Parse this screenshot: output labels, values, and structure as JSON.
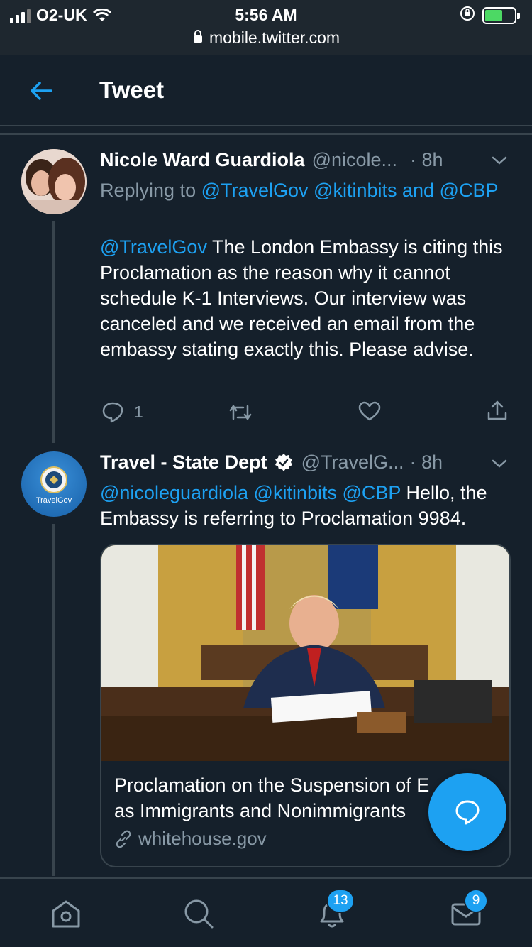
{
  "status_bar": {
    "carrier": "O2-UK",
    "time": "5:56 AM",
    "url": "mobile.twitter.com"
  },
  "header": {
    "title": "Tweet"
  },
  "tweet1": {
    "name": "Nicole Ward Guardiola",
    "handle": "@nicole...",
    "time": "· 8h",
    "replying_prefix": "Replying to",
    "replying_mentions": "@TravelGov @kitinbits and @CBP",
    "mention": "@TravelGov",
    "text": "The London Embassy is citing this Proclamation as the reason why it cannot schedule K-1 Interviews. Our interview was canceled and we received an email from the embassy stating exactly this. Please advise.",
    "reply_count": "1"
  },
  "tweet2": {
    "name": "Travel - State Dept",
    "handle": "@TravelG...",
    "time": "· 8h",
    "mentions": "@nicoleguardiola @kitinbits @CBP",
    "text": "Hello, the Embassy is referring to Proclamation 9984.",
    "avatar_label": "TravelGov",
    "card": {
      "title_line1": "Proclamation on the Suspension of E",
      "title_line2": "as Immigrants and Nonimmigrants",
      "domain": "whitehouse.gov"
    }
  },
  "bottom_nav": {
    "notifications_badge": "13",
    "messages_badge": "9"
  },
  "colors": {
    "background": "#15202b",
    "accent": "#1da1f2",
    "secondary_text": "#8899a6",
    "divider": "#38444d"
  },
  "icons": [
    "back-arrow-icon",
    "chevron-down-icon",
    "reply-icon",
    "retweet-icon",
    "like-icon",
    "share-icon",
    "verified-icon",
    "link-icon",
    "compose-icon",
    "home-icon",
    "search-icon",
    "bell-icon",
    "mail-icon"
  ]
}
